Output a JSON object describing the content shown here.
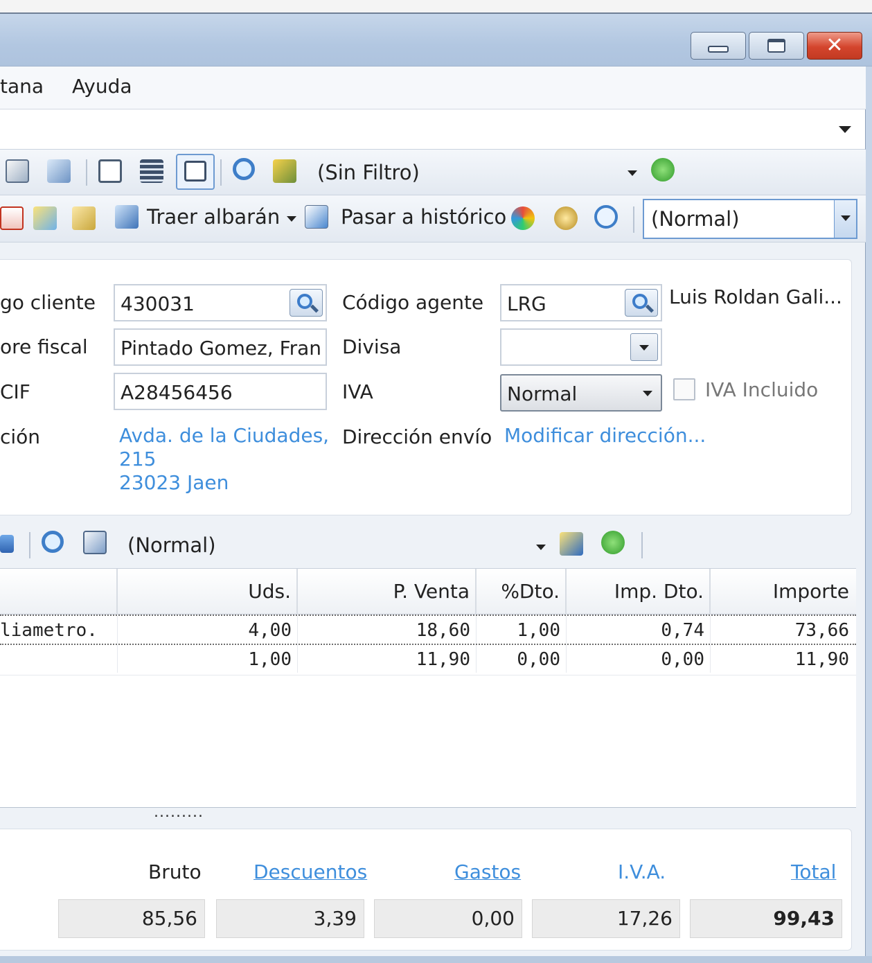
{
  "window": {
    "minimize_label": "",
    "maximize_label": "",
    "close_glyph": "✕"
  },
  "menu": {
    "items": [
      "tana",
      "Ayuda"
    ]
  },
  "toolbar1": {
    "filter_label": "(Sin Filtro)"
  },
  "toolbar2": {
    "traer_albaran": "Traer albarán",
    "pasar_historico": "Pasar a histórico",
    "view_mode": "(Normal)"
  },
  "form": {
    "codigo_cliente_label": "go cliente",
    "codigo_cliente_value": "430031",
    "nombre_fiscal_label": "ore fiscal",
    "nombre_fiscal_value": "Pintado Gomez, Francis",
    "cif_label": "CIF",
    "cif_value": "A28456456",
    "direccion_label": "ción",
    "direccion_line1": "Avda. de la Ciudades,",
    "direccion_line2": "215",
    "direccion_line3": "23023 Jaen",
    "codigo_agente_label": "Código agente",
    "codigo_agente_value": "LRG",
    "agente_nombre": "Luis Roldan Gali...",
    "divisa_label": "Divisa",
    "divisa_value": "",
    "iva_label": "IVA",
    "iva_value": "Normal",
    "iva_incluido_label": "IVA Incluido",
    "iva_incluido_checked": false,
    "direccion_envio_label": "Dirección envío",
    "modificar_direccion_link": "Modificar dirección..."
  },
  "lines_toolbar": {
    "view_mode": "(Normal)"
  },
  "grid": {
    "columns": [
      "Uds.",
      "P. Venta",
      "%Dto.",
      "Imp. Dto.",
      "Importe"
    ],
    "rows": [
      {
        "desc": "liametro.",
        "uds": "4,00",
        "pventa": "18,60",
        "dto": "1,00",
        "impdto": "0,74",
        "importe": "73,66"
      },
      {
        "desc": "",
        "uds": "1,00",
        "pventa": "11,90",
        "dto": "0,00",
        "impdto": "0,00",
        "importe": "11,90"
      }
    ],
    "splitter": "........."
  },
  "totals": {
    "bruto_label": "Bruto",
    "descuentos_label": "Descuentos",
    "gastos_label": "Gastos",
    "iva_label": "I.V.A.",
    "total_label": "Total",
    "bruto_value": "85,56",
    "descuentos_value": "3,39",
    "gastos_value": "0,00",
    "iva_value": "17,26",
    "total_value": "99,43"
  },
  "colors": {
    "link": "#3e8edc",
    "titlebar": "#b2c7e1",
    "close_button": "#d4452d"
  }
}
